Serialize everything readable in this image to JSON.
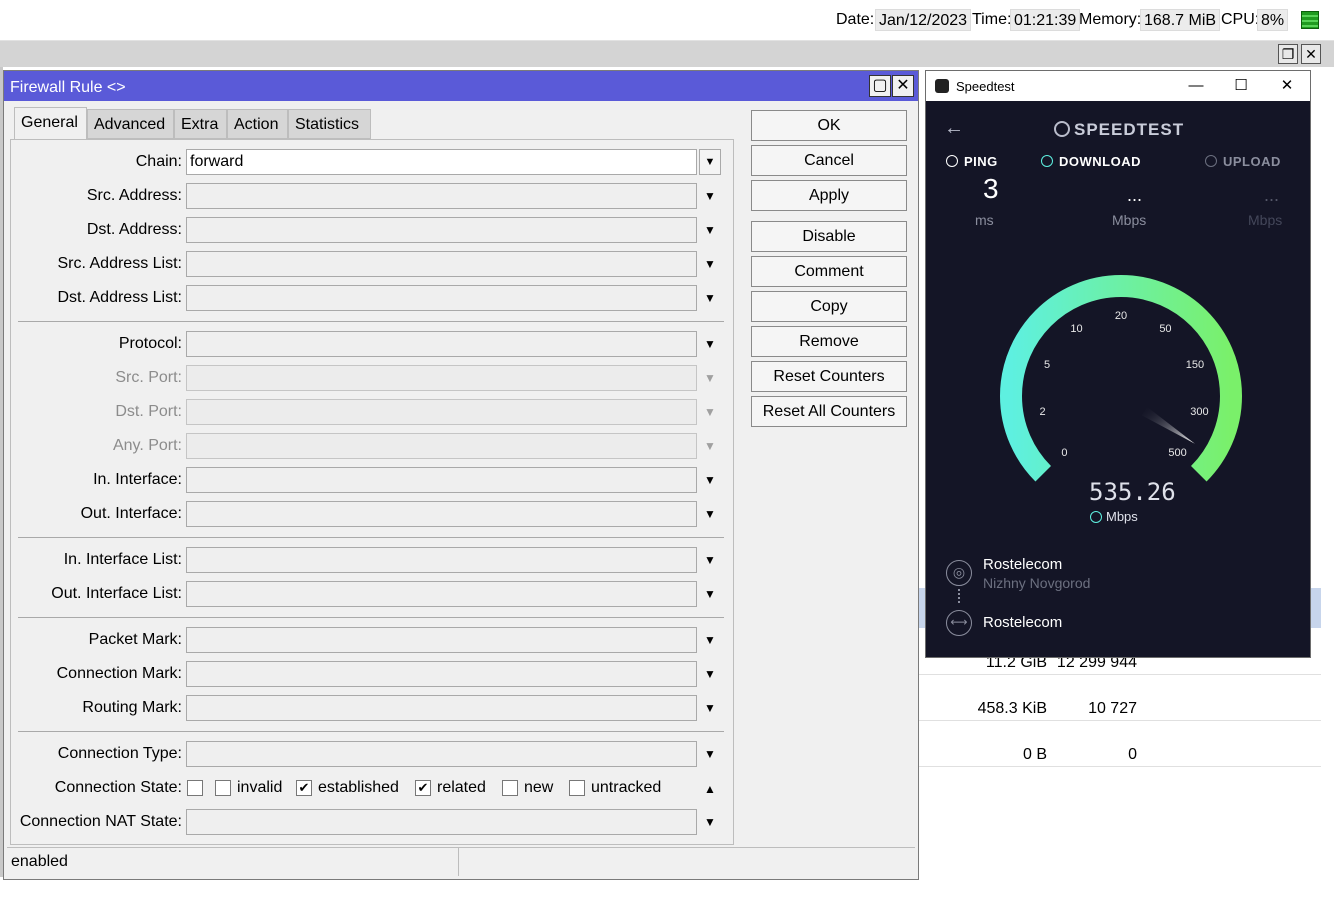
{
  "topbar": {
    "date_label": "Date:",
    "date": "Jan/12/2023",
    "time_label": "Time:",
    "time": "01:21:39",
    "memory_label": "Memory:",
    "memory": "168.7 MiB",
    "cpu_label": "CPU:",
    "cpu": "8%"
  },
  "background_table": [
    {
      "bytes": "11.2 GiB",
      "packets": "12 299 944"
    },
    {
      "bytes": "458.3 KiB",
      "packets": "10 727"
    },
    {
      "bytes": "0 B",
      "packets": "0"
    }
  ],
  "dialog": {
    "title": "Firewall Rule <>",
    "tabs": [
      "General",
      "Advanced",
      "Extra",
      "Action",
      "Statistics"
    ],
    "active_tab": "General",
    "fields": {
      "chain_label": "Chain:",
      "chain_value": "forward",
      "src_address": "Src. Address:",
      "dst_address": "Dst. Address:",
      "src_address_list": "Src. Address List:",
      "dst_address_list": "Dst. Address List:",
      "protocol": "Protocol:",
      "src_port": "Src. Port:",
      "dst_port": "Dst. Port:",
      "any_port": "Any. Port:",
      "in_interface": "In. Interface:",
      "out_interface": "Out. Interface:",
      "in_interface_list": "In. Interface List:",
      "out_interface_list": "Out. Interface List:",
      "packet_mark": "Packet Mark:",
      "connection_mark": "Connection Mark:",
      "routing_mark": "Routing Mark:",
      "connection_type": "Connection Type:",
      "connection_state": "Connection State:",
      "connection_nat_state": "Connection NAT State:"
    },
    "connection_state_options": [
      {
        "label": "",
        "checked": false
      },
      {
        "label": "invalid",
        "checked": false
      },
      {
        "label": "established",
        "checked": true
      },
      {
        "label": "related",
        "checked": true
      },
      {
        "label": "new",
        "checked": false
      },
      {
        "label": "untracked",
        "checked": false
      }
    ],
    "buttons": {
      "ok": "OK",
      "cancel": "Cancel",
      "apply": "Apply",
      "disable": "Disable",
      "comment": "Comment",
      "copy": "Copy",
      "remove": "Remove",
      "reset_counters": "Reset Counters",
      "reset_all_counters": "Reset All Counters"
    },
    "status": "enabled"
  },
  "speedtest": {
    "window_title": "Speedtest",
    "brand": "SPEEDTEST",
    "ping_label": "PING",
    "ping_value": "3",
    "ping_unit": "ms",
    "download_label": "DOWNLOAD",
    "download_value": "...",
    "download_unit": "Mbps",
    "upload_label": "UPLOAD",
    "upload_value": "...",
    "upload_unit": "Mbps",
    "gauge_ticks": [
      "0",
      "2",
      "5",
      "10",
      "20",
      "50",
      "150",
      "300",
      "500"
    ],
    "current_speed": "535.26",
    "current_unit": "Mbps",
    "isp_name": "Rostelecom",
    "isp_location": "Nizhny Novgorod",
    "server_name": "Rostelecom",
    "colors": {
      "gauge_start": "#5ef0e0",
      "gauge_end": "#7af06a",
      "background": "#141526"
    }
  }
}
